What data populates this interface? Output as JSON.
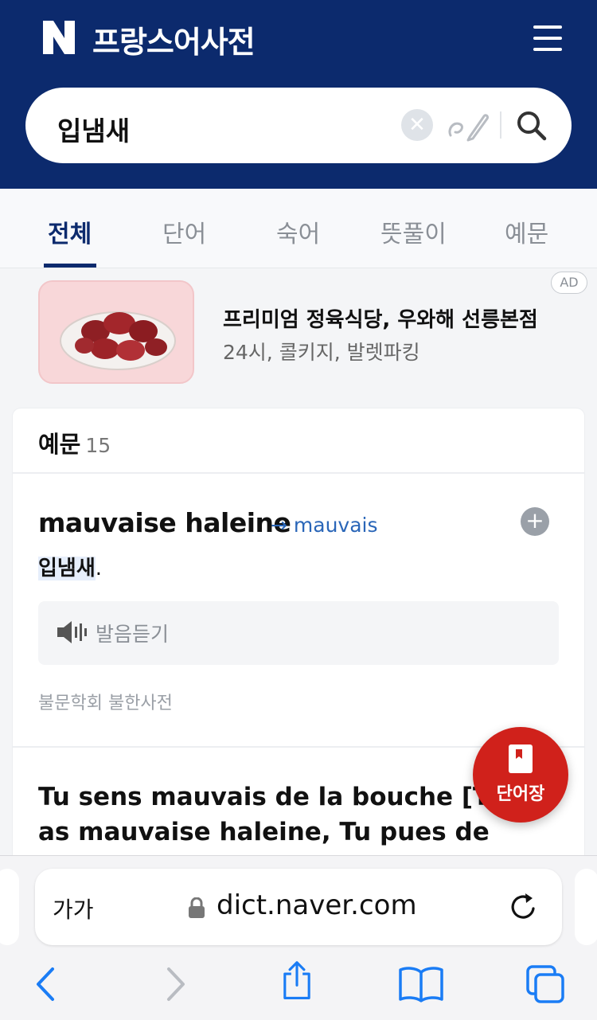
{
  "header": {
    "logo": "N",
    "title": "프랑스어사전",
    "menu_icon": "hamburger-icon"
  },
  "search": {
    "query": "입냄새",
    "clear_icon": "close-icon",
    "handwriting_icon": "handwriting-icon",
    "search_icon": "search-icon"
  },
  "tabs": [
    {
      "label": "전체",
      "active": true
    },
    {
      "label": "단어",
      "active": false
    },
    {
      "label": "숙어",
      "active": false
    },
    {
      "label": "뜻풀이",
      "active": false
    },
    {
      "label": "예문",
      "active": false
    }
  ],
  "ad": {
    "badge": "AD",
    "title": "프리미엄 정육식당, 우와해 선릉본점",
    "subtitle": "24시, 콜키지, 발렛파킹"
  },
  "section": {
    "title": "예문",
    "count": "15"
  },
  "entry": {
    "phrase": "mauvaise haleine",
    "link_arrow": "→",
    "link_word": "mauvais",
    "meaning_highlight": "입냄새",
    "meaning_rest": ".",
    "listen_label": "발음듣기",
    "source": "불문학회 불한사전"
  },
  "entry2": {
    "sentence": "Tu sens mauvais de la bouche [Tu as mauvaise haleine, Tu pues de la"
  },
  "fab": {
    "label": "단어장"
  },
  "browser": {
    "text_size": "가가",
    "url": "dict.naver.com"
  },
  "colors": {
    "header_bg": "#0c2a6d",
    "link": "#2a66b8",
    "fab_bg": "#d0211b",
    "ios_blue": "#1a7cf5"
  }
}
